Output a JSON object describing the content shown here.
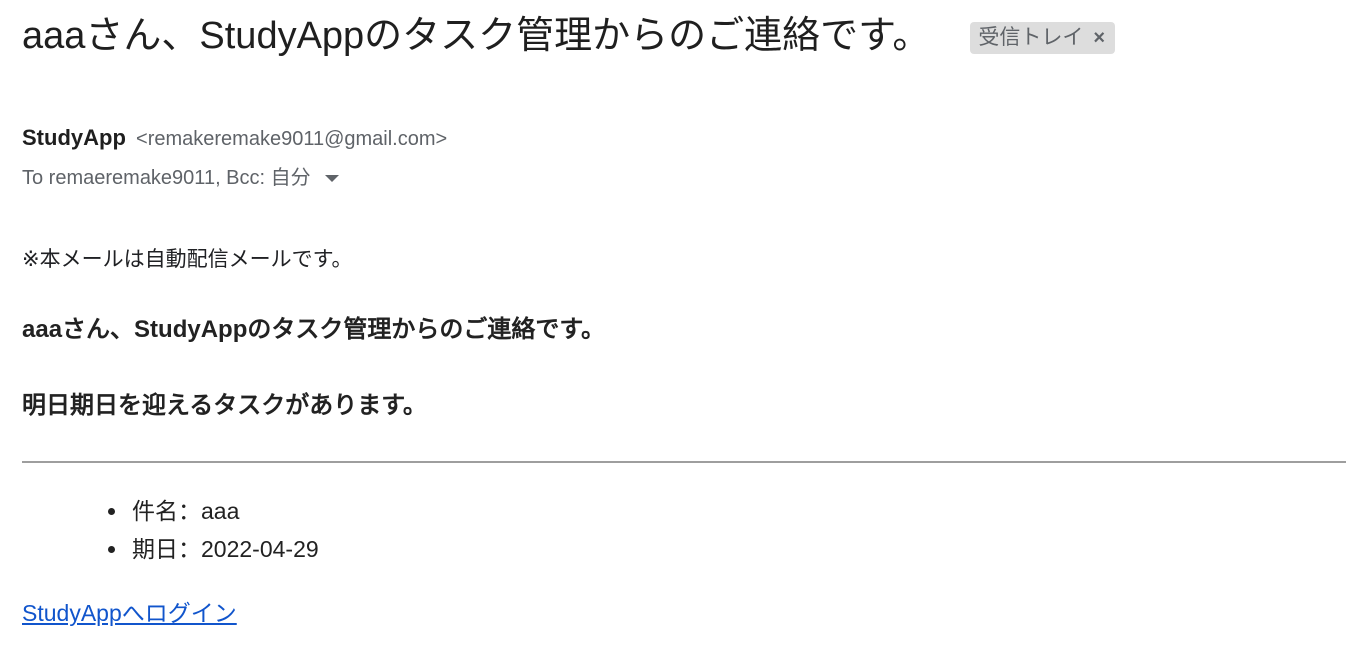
{
  "email": {
    "subject": "aaaさん、StudyAppのタスク管理からのご連絡です。",
    "label_chip": {
      "label": "受信トレイ",
      "close_glyph": "×"
    },
    "sender": {
      "name": "StudyApp",
      "email": "<remakeremake9011@gmail.com>"
    },
    "recipients": "To remaeremake9011, Bcc: 自分",
    "body": {
      "notice": "※本メールは自動配信メールです。",
      "heading": "aaaさん、StudyAppのタスク管理からのご連絡です。",
      "subheading": "明日期日を迎えるタスクがあります。",
      "details": [
        "件名：aaa",
        "期日：2022-04-29"
      ],
      "login_link": "StudyAppへログイン"
    }
  },
  "colors": {
    "link": "#1155cc",
    "chip_background": "#dddddd",
    "muted_text": "#5f6368"
  },
  "icons": {
    "chip_close": "close-icon",
    "recipients_toggle": "chevron-down-icon"
  }
}
